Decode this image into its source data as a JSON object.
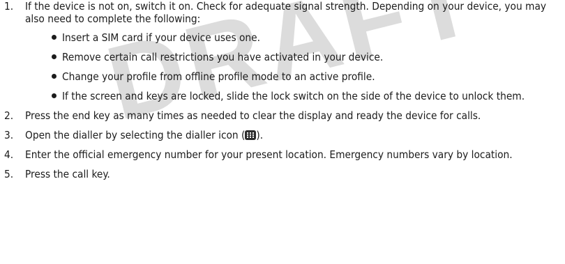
{
  "watermark": "DRAFT",
  "steps": [
    {
      "num": "1.",
      "text": "If the device is not on, switch it on. Check for adequate signal strength. Depending on your device, you may also need to complete the following:",
      "bullets": [
        "Insert a SIM card if your device uses one.",
        "Remove certain call restrictions you have activated in your device.",
        "Change your profile from offline profile mode to an active profile.",
        "If the screen and keys are locked, slide the lock switch on the side of the device to unlock them."
      ]
    },
    {
      "num": "2.",
      "text": "Press the end key as many times as needed to clear the display and ready the device for calls."
    },
    {
      "num": "3.",
      "text_before": "Open the dialler by selecting the dialler icon (",
      "icon": "dialler-grid-icon",
      "text_after": ")."
    },
    {
      "num": "4.",
      "text": "Enter the official emergency number for your present location. Emergency numbers vary by location."
    },
    {
      "num": "5.",
      "text": "Press the call key."
    }
  ]
}
